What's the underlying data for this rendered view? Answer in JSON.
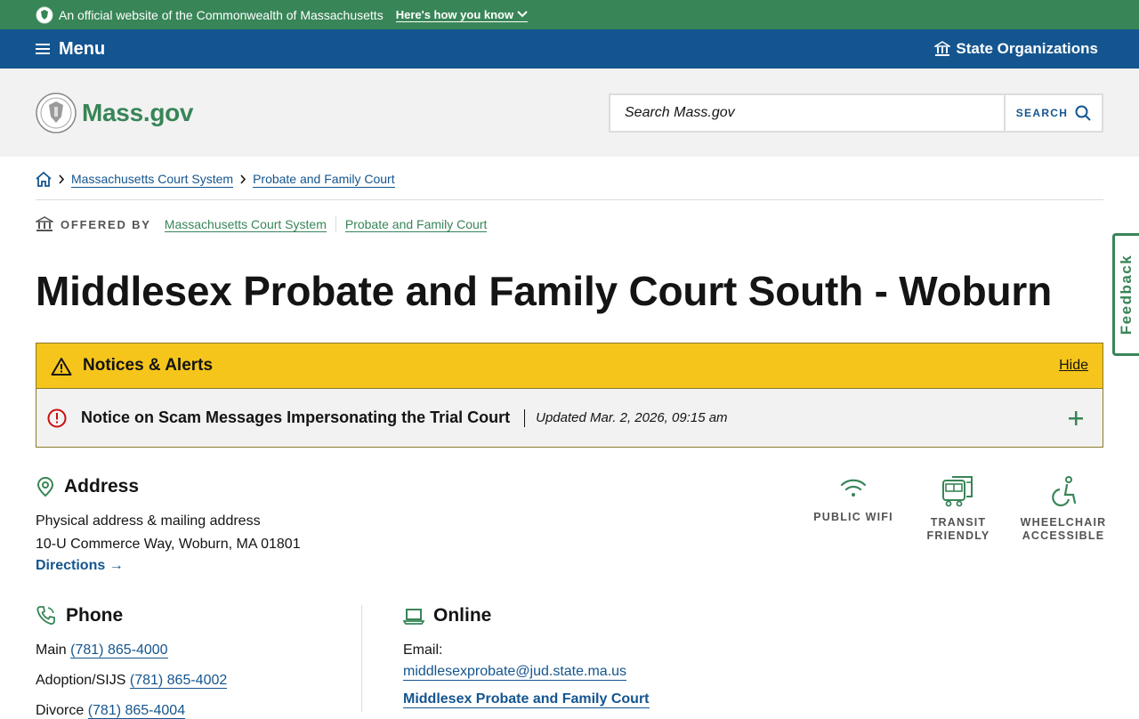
{
  "official_banner": {
    "text": "An official website of the Commonwealth of Massachusetts",
    "link": "Here's how you know"
  },
  "nav": {
    "menu_label": "Menu",
    "orgs_label": "State Organizations"
  },
  "header": {
    "logo_text": "Mass.gov",
    "search_placeholder": "Search Mass.gov",
    "search_button": "SEARCH"
  },
  "breadcrumb": [
    "Massachusetts Court System",
    "Probate and Family Court"
  ],
  "offered_by": {
    "label": "OFFERED BY",
    "orgs": [
      "Massachusetts Court System",
      "Probate and Family Court"
    ]
  },
  "page_title": "Middlesex Probate and Family Court South - Woburn",
  "alerts": {
    "title": "Notices & Alerts",
    "hide": "Hide",
    "notice_title": "Notice on Scam Messages Impersonating the Trial Court",
    "notice_updated": "Updated Mar. 2, 2026, 09:15 am"
  },
  "address": {
    "heading": "Address",
    "type": "Physical address & mailing address",
    "line": "10-U Commerce Way, Woburn, MA 01801",
    "directions": "Directions →"
  },
  "amenities": [
    "PUBLIC WIFI",
    "TRANSIT FRIENDLY",
    "WHEELCHAIR ACCESSIBLE"
  ],
  "phone": {
    "heading": "Phone",
    "rows": [
      {
        "label": "Main",
        "number": "(781) 865-4000"
      },
      {
        "label": "Adoption/SIJS",
        "number": "(781) 865-4002"
      },
      {
        "label": "Divorce",
        "number": "(781) 865-4004"
      }
    ]
  },
  "online": {
    "heading": "Online",
    "email_label": "Email:",
    "email": "middlesexprobate@jud.state.ma.us",
    "link": "Middlesex Probate and Family Court"
  },
  "feedback": "Feedback",
  "colors": {
    "green": "#388557",
    "blue": "#14558f",
    "alert_yellow": "#f6c51b"
  }
}
